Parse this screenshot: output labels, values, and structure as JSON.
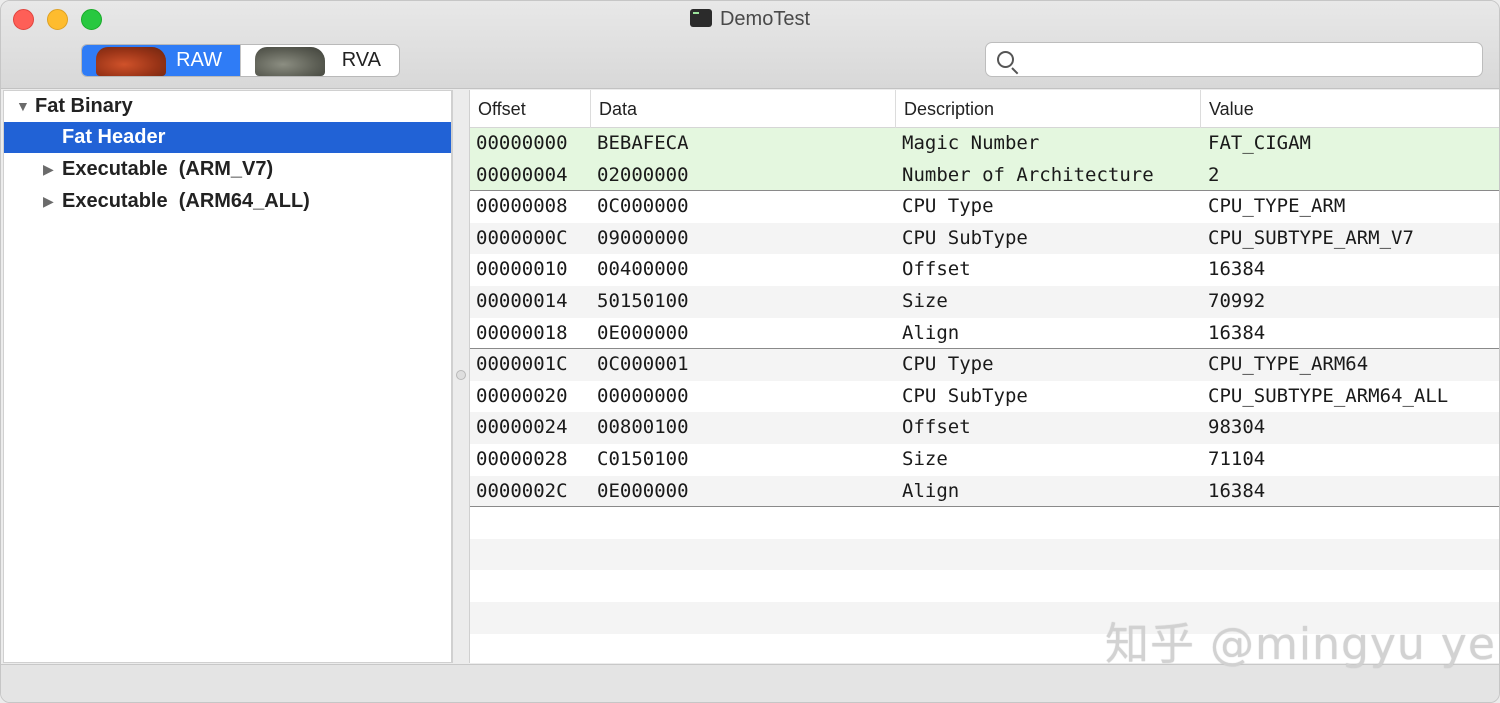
{
  "window": {
    "title": "DemoTest"
  },
  "toolbar": {
    "modes": [
      {
        "label": "RAW",
        "active": true
      },
      {
        "label": "RVA",
        "active": false
      }
    ],
    "search": {
      "value": "",
      "placeholder": ""
    }
  },
  "sidebar": {
    "items": [
      {
        "label": "Fat Binary",
        "expanded": true,
        "level": 0,
        "selected": false
      },
      {
        "label": "Fat Header",
        "level": 1,
        "selected": true
      },
      {
        "label": "Executable  (ARM_V7)",
        "expanded": false,
        "level": 1,
        "selected": false
      },
      {
        "label": "Executable  (ARM64_ALL)",
        "expanded": false,
        "level": 1,
        "selected": false
      }
    ]
  },
  "table": {
    "columns": [
      "Offset",
      "Data",
      "Description",
      "Value"
    ],
    "rows": [
      {
        "offset": "00000000",
        "data": "BEBAFECA",
        "description": "Magic Number",
        "value": "FAT_CIGAM"
      },
      {
        "offset": "00000004",
        "data": "02000000",
        "description": "Number of Architecture",
        "value": "2"
      },
      {
        "offset": "00000008",
        "data": "0C000000",
        "description": "CPU Type",
        "value": "CPU_TYPE_ARM"
      },
      {
        "offset": "0000000C",
        "data": "09000000",
        "description": "CPU SubType",
        "value": "CPU_SUBTYPE_ARM_V7"
      },
      {
        "offset": "00000010",
        "data": "00400000",
        "description": "Offset",
        "value": "16384"
      },
      {
        "offset": "00000014",
        "data": "50150100",
        "description": "Size",
        "value": "70992"
      },
      {
        "offset": "00000018",
        "data": "0E000000",
        "description": "Align",
        "value": "16384"
      },
      {
        "offset": "0000001C",
        "data": "0C000001",
        "description": "CPU Type",
        "value": "CPU_TYPE_ARM64"
      },
      {
        "offset": "00000020",
        "data": "00000000",
        "description": "CPU SubType",
        "value": "CPU_SUBTYPE_ARM64_ALL"
      },
      {
        "offset": "00000024",
        "data": "00800100",
        "description": "Offset",
        "value": "98304"
      },
      {
        "offset": "00000028",
        "data": "C0150100",
        "description": "Size",
        "value": "71104"
      },
      {
        "offset": "0000002C",
        "data": "0E000000",
        "description": "Align",
        "value": "16384"
      }
    ]
  },
  "watermark": "知乎 @mingyu ye",
  "colors": {
    "selection": "#2162d6",
    "accent": "#2f7cf6",
    "highlight_row": "#e4f7df"
  }
}
